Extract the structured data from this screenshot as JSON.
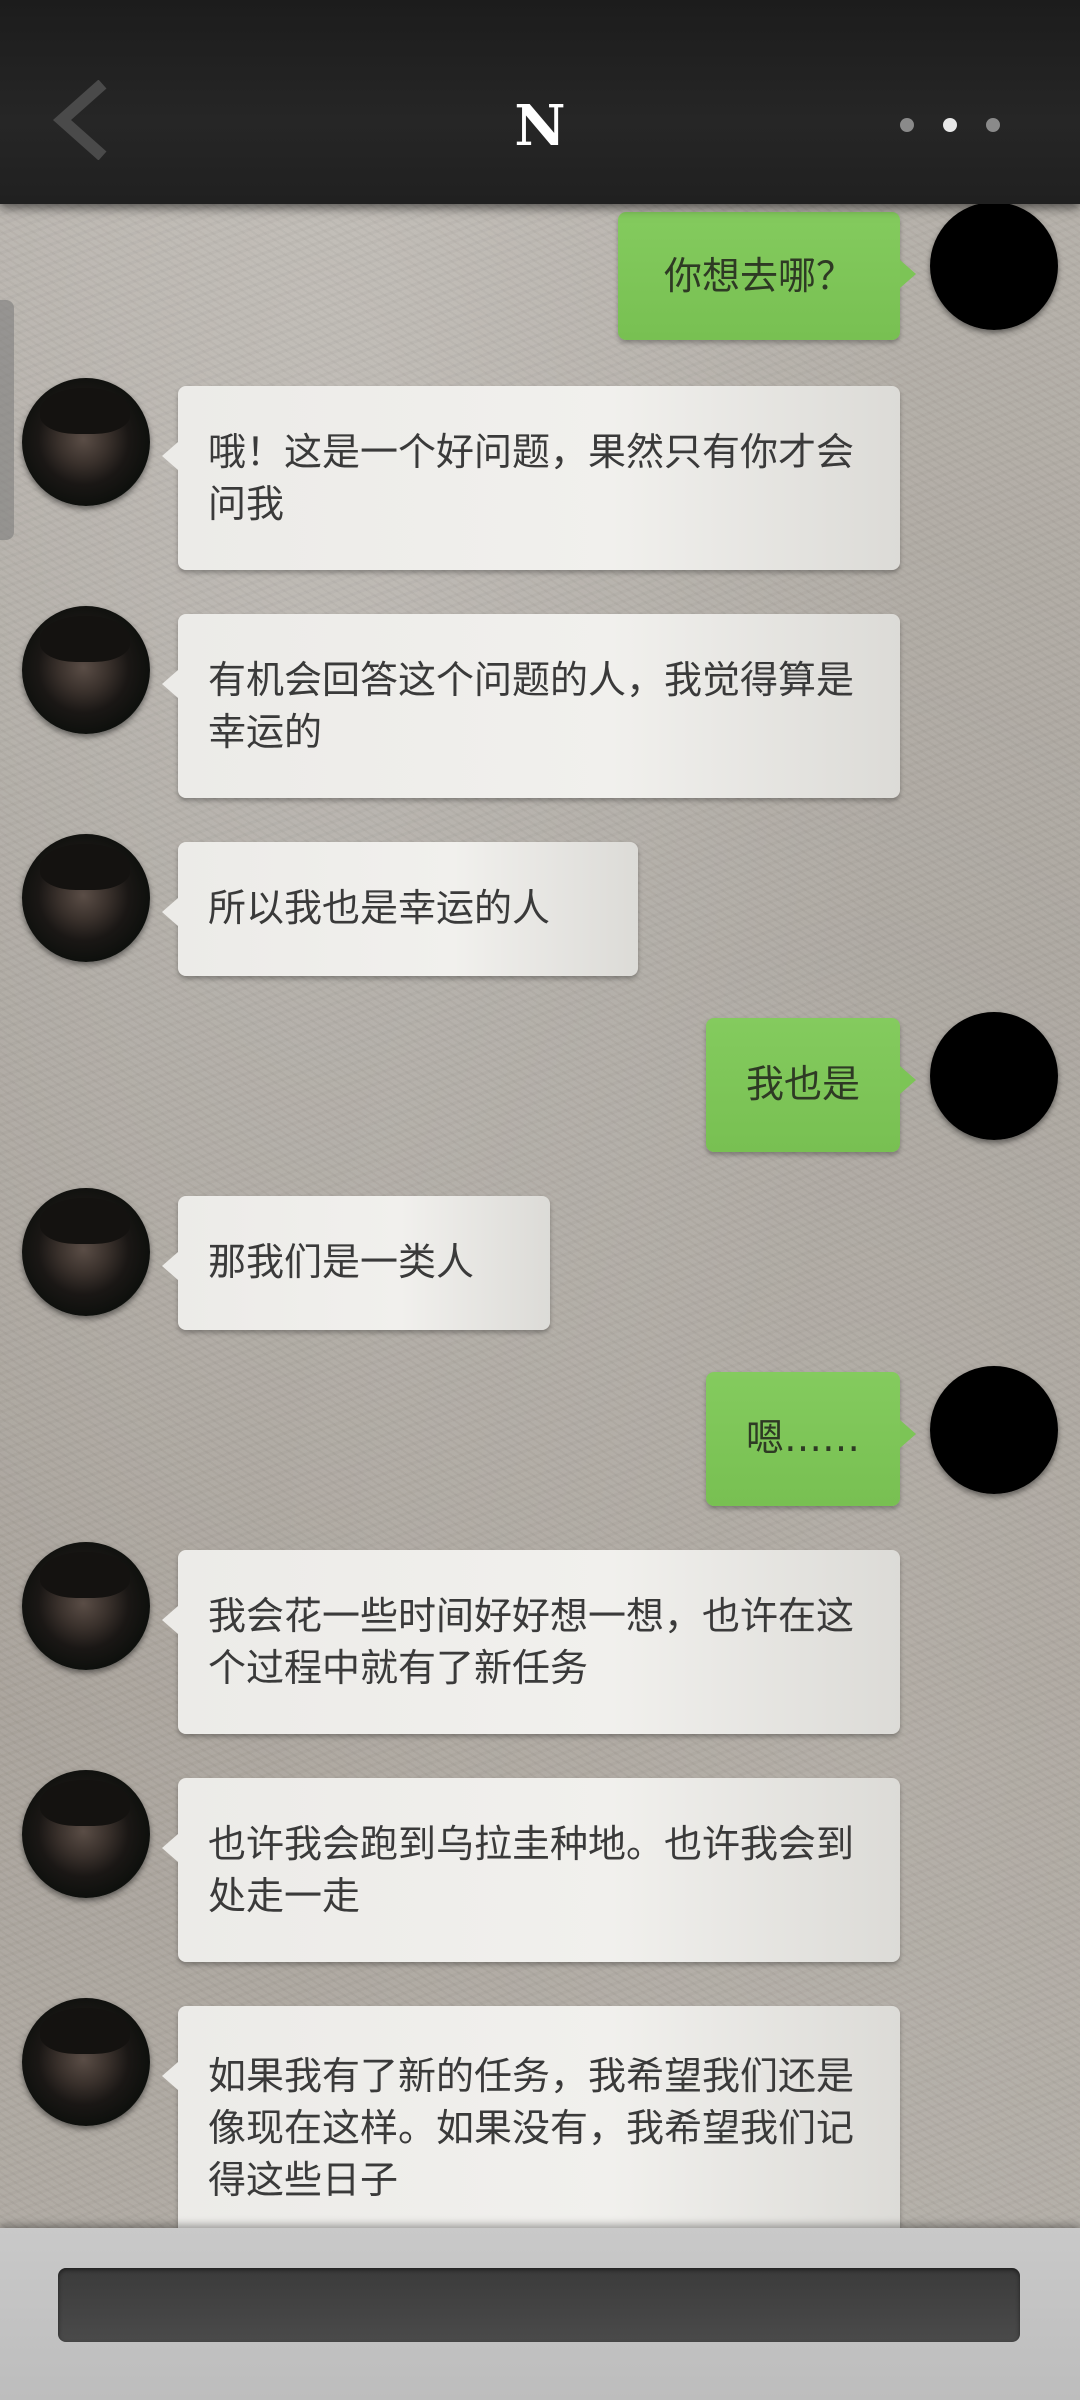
{
  "header": {
    "title": "N",
    "back_icon": "chevron-left-icon",
    "more_icon": "more-dots-icon"
  },
  "messages": [
    {
      "side": "right",
      "text": "你想去哪？"
    },
    {
      "side": "left",
      "text": "哦！这是一个好问题，果然只有你才会问我"
    },
    {
      "side": "left",
      "text": "有机会回答这个问题的人，我觉得算是幸运的"
    },
    {
      "side": "left",
      "text": "所以我也是幸运的人"
    },
    {
      "side": "right",
      "text": "我也是"
    },
    {
      "side": "left",
      "text": "那我们是一类人"
    },
    {
      "side": "right",
      "text": "嗯……"
    },
    {
      "side": "left",
      "text": "我会花一些时间好好想一想，也许在这个过程中就有了新任务"
    },
    {
      "side": "left",
      "text": "也许我会跑到乌拉圭种地。也许我会到处走一走"
    },
    {
      "side": "left",
      "text": "如果我有了新的任务，我希望我们还是像现在这样。如果没有，我希望我们记得这些日子"
    }
  ],
  "composer": {
    "value": "",
    "placeholder": ""
  },
  "colors": {
    "header_bg": "#222222",
    "self_bubble": "#7cc456",
    "other_bubble": "#ecebe8",
    "wall_bg": "#aca79f"
  }
}
